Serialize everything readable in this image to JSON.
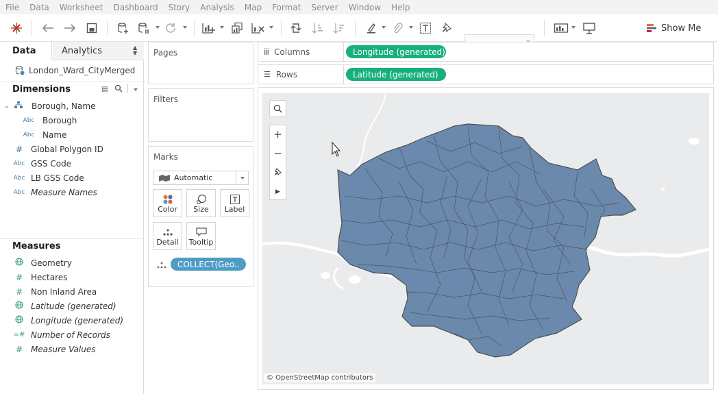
{
  "menu": [
    "File",
    "Data",
    "Worksheet",
    "Dashboard",
    "Story",
    "Analysis",
    "Map",
    "Format",
    "Server",
    "Window",
    "Help"
  ],
  "toolbar": {
    "show_me_label": "Show Me",
    "tableau-logo": "tableau-logo-icon"
  },
  "sidepanel": {
    "tab_data": "Data",
    "tab_analytics": "Analytics",
    "datasource": "London_Ward_CityMerged",
    "dimensions_title": "Dimensions",
    "dimensions": [
      {
        "label": "Borough, Name",
        "icon": "hierarchy-icon"
      },
      {
        "label": "Borough",
        "icon": "Abc"
      },
      {
        "label": "Name",
        "icon": "Abc"
      },
      {
        "label": "Global Polygon ID",
        "icon": "#"
      },
      {
        "label": "GSS Code",
        "icon": "Abc"
      },
      {
        "label": "LB GSS Code",
        "icon": "Abc"
      },
      {
        "label": "Measure Names",
        "icon": "Abc"
      }
    ],
    "measures_title": "Measures",
    "measures": [
      {
        "label": "Geometry",
        "icon": "globe-icon"
      },
      {
        "label": "Hectares",
        "icon": "#"
      },
      {
        "label": "Non Inland Area",
        "icon": "#"
      },
      {
        "label": "Latitude (generated)",
        "icon": "globe-icon"
      },
      {
        "label": "Longitude (generated)",
        "icon": "globe-icon"
      },
      {
        "label": "Number of Records",
        "icon": "=#"
      },
      {
        "label": "Measure Values",
        "icon": "#"
      }
    ]
  },
  "cards": {
    "pages_title": "Pages",
    "filters_title": "Filters",
    "marks_title": "Marks",
    "mark_type": "Automatic",
    "mark_buttons": [
      "Color",
      "Size",
      "Label",
      "Detail",
      "Tooltip"
    ],
    "detail_pill": "COLLECT(Geo.."
  },
  "shelves": {
    "columns_label": "Columns",
    "columns_pill": "Longitude (generated)",
    "rows_label": "Rows",
    "rows_pill": "Latitude (generated)"
  },
  "map": {
    "attribution": "© OpenStreetMap contributors",
    "fill_color": "#6b89ac",
    "border_color": "#4a4f57"
  },
  "colors": {
    "pill_green": "#16b07a",
    "pill_blue": "#4e9cc4"
  }
}
